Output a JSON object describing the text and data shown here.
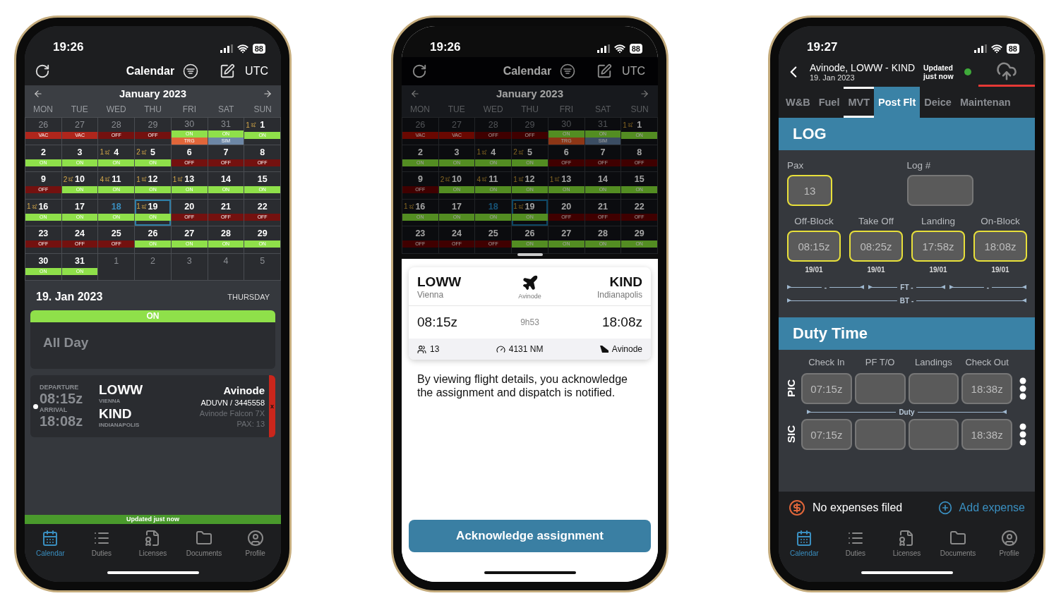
{
  "phones": [
    {
      "kind": "calendar",
      "status": {
        "time": "19:26",
        "battery": "88"
      },
      "header": {
        "title": "Calendar",
        "timezone": "UTC"
      },
      "month": "January 2023",
      "weekdays": [
        "MON",
        "TUE",
        "WED",
        "THU",
        "FRI",
        "SAT",
        "SUN"
      ],
      "weeks": [
        [
          {
            "day": "26",
            "outside": true,
            "today": false,
            "selected": false,
            "duties": [
              {
                "kind": "vac",
                "label": "VAC"
              }
            ]
          },
          {
            "day": "27",
            "outside": true,
            "today": false,
            "selected": false,
            "duties": [
              {
                "kind": "vac",
                "label": "VAC"
              }
            ]
          },
          {
            "day": "28",
            "outside": true,
            "today": false,
            "selected": false,
            "duties": [
              {
                "kind": "off",
                "label": "OFF"
              }
            ]
          },
          {
            "day": "29",
            "outside": true,
            "today": false,
            "selected": false,
            "duties": [
              {
                "kind": "off",
                "label": "OFF"
              }
            ]
          },
          {
            "day": "30",
            "outside": true,
            "today": false,
            "selected": false,
            "duties": [
              {
                "kind": "on",
                "label": "ON"
              },
              {
                "kind": "trg",
                "label": "TRG"
              }
            ]
          },
          {
            "day": "31",
            "outside": true,
            "today": false,
            "selected": false,
            "duties": [
              {
                "kind": "on",
                "label": "ON"
              },
              {
                "kind": "sim",
                "label": "SIM"
              }
            ]
          },
          {
            "day": "1",
            "flights": "1",
            "outside": false,
            "today": false,
            "selected": false,
            "duties": [
              {
                "kind": "on",
                "label": "ON"
              }
            ]
          }
        ],
        [
          {
            "day": "2",
            "outside": false,
            "today": false,
            "selected": false,
            "duties": [
              {
                "kind": "on",
                "label": "ON"
              }
            ]
          },
          {
            "day": "3",
            "outside": false,
            "today": false,
            "selected": false,
            "duties": [
              {
                "kind": "on",
                "label": "ON"
              }
            ]
          },
          {
            "day": "4",
            "flights": "1",
            "outside": false,
            "today": false,
            "selected": false,
            "duties": [
              {
                "kind": "on",
                "label": "ON"
              }
            ]
          },
          {
            "day": "5",
            "flights": "2",
            "outside": false,
            "today": false,
            "selected": false,
            "duties": [
              {
                "kind": "on",
                "label": "ON"
              }
            ]
          },
          {
            "day": "6",
            "outside": false,
            "today": false,
            "selected": false,
            "duties": [
              {
                "kind": "off",
                "label": "OFF"
              }
            ]
          },
          {
            "day": "7",
            "outside": false,
            "today": false,
            "selected": false,
            "duties": [
              {
                "kind": "off",
                "label": "OFF"
              }
            ]
          },
          {
            "day": "8",
            "outside": false,
            "today": false,
            "selected": false,
            "duties": [
              {
                "kind": "off",
                "label": "OFF"
              }
            ]
          }
        ],
        [
          {
            "day": "9",
            "outside": false,
            "today": false,
            "selected": false,
            "duties": [
              {
                "kind": "off",
                "label": "OFF"
              }
            ]
          },
          {
            "day": "10",
            "flights": "2",
            "outside": false,
            "today": false,
            "selected": false,
            "duties": [
              {
                "kind": "on",
                "label": "ON"
              }
            ]
          },
          {
            "day": "11",
            "flights": "4",
            "outside": false,
            "today": false,
            "selected": false,
            "duties": [
              {
                "kind": "on",
                "label": "ON"
              }
            ]
          },
          {
            "day": "12",
            "flights": "1",
            "outside": false,
            "today": false,
            "selected": false,
            "duties": [
              {
                "kind": "on",
                "label": "ON"
              }
            ]
          },
          {
            "day": "13",
            "flights": "1",
            "outside": false,
            "today": false,
            "selected": false,
            "duties": [
              {
                "kind": "on",
                "label": "ON"
              }
            ]
          },
          {
            "day": "14",
            "outside": false,
            "today": false,
            "selected": false,
            "duties": [
              {
                "kind": "on",
                "label": "ON"
              }
            ]
          },
          {
            "day": "15",
            "outside": false,
            "today": false,
            "selected": false,
            "duties": [
              {
                "kind": "on",
                "label": "ON"
              }
            ]
          }
        ],
        [
          {
            "day": "16",
            "flights": "1",
            "outside": false,
            "today": false,
            "selected": false,
            "duties": [
              {
                "kind": "on",
                "label": "ON"
              }
            ]
          },
          {
            "day": "17",
            "outside": false,
            "today": false,
            "selected": false,
            "duties": [
              {
                "kind": "on",
                "label": "ON"
              }
            ]
          },
          {
            "day": "18",
            "outside": false,
            "today": true,
            "selected": false,
            "duties": [
              {
                "kind": "on",
                "label": "ON"
              }
            ]
          },
          {
            "day": "19",
            "flights": "1",
            "outside": false,
            "today": false,
            "selected": true,
            "duties": [
              {
                "kind": "on",
                "label": "ON"
              }
            ]
          },
          {
            "day": "20",
            "outside": false,
            "today": false,
            "selected": false,
            "duties": [
              {
                "kind": "off",
                "label": "OFF"
              }
            ]
          },
          {
            "day": "21",
            "outside": false,
            "today": false,
            "selected": false,
            "duties": [
              {
                "kind": "off",
                "label": "OFF"
              }
            ]
          },
          {
            "day": "22",
            "outside": false,
            "today": false,
            "selected": false,
            "duties": [
              {
                "kind": "off",
                "label": "OFF"
              }
            ]
          }
        ],
        [
          {
            "day": "23",
            "outside": false,
            "today": false,
            "selected": false,
            "duties": [
              {
                "kind": "off",
                "label": "OFF"
              }
            ]
          },
          {
            "day": "24",
            "outside": false,
            "today": false,
            "selected": false,
            "duties": [
              {
                "kind": "off",
                "label": "OFF"
              }
            ]
          },
          {
            "day": "25",
            "outside": false,
            "today": false,
            "selected": false,
            "duties": [
              {
                "kind": "off",
                "label": "OFF"
              }
            ]
          },
          {
            "day": "26",
            "outside": false,
            "today": false,
            "selected": false,
            "duties": [
              {
                "kind": "on",
                "label": "ON"
              }
            ]
          },
          {
            "day": "27",
            "outside": false,
            "today": false,
            "selected": false,
            "duties": [
              {
                "kind": "on",
                "label": "ON"
              }
            ]
          },
          {
            "day": "28",
            "outside": false,
            "today": false,
            "selected": false,
            "duties": [
              {
                "kind": "on",
                "label": "ON"
              }
            ]
          },
          {
            "day": "29",
            "outside": false,
            "today": false,
            "selected": false,
            "duties": [
              {
                "kind": "on",
                "label": "ON"
              }
            ]
          }
        ],
        [
          {
            "day": "30",
            "outside": false,
            "today": false,
            "selected": false,
            "duties": [
              {
                "kind": "on",
                "label": "ON"
              }
            ]
          },
          {
            "day": "31",
            "outside": false,
            "today": false,
            "selected": false,
            "duties": [
              {
                "kind": "on",
                "label": "ON"
              }
            ]
          },
          {
            "day": "1",
            "outside": true,
            "today": false,
            "selected": false
          },
          {
            "day": "2",
            "outside": true,
            "today": false,
            "selected": false
          },
          {
            "day": "3",
            "outside": true,
            "today": false,
            "selected": false
          },
          {
            "day": "4",
            "outside": true,
            "today": false,
            "selected": false
          },
          {
            "day": "5",
            "outside": true,
            "today": false,
            "selected": false
          }
        ]
      ],
      "day_detail": {
        "date": "19. Jan 2023",
        "weekday": "THURSDAY",
        "status": {
          "kind": "on",
          "label": "ON"
        },
        "all_day": "All Day"
      },
      "flight": {
        "departure_label": "DEPARTURE",
        "departure_time": "08:15z",
        "arrival_label": "ARRIVAL",
        "arrival_time": "18:08z",
        "from": "LOWW",
        "from_city": "VIENNA",
        "to": "KIND",
        "to_city": "INDIANAPOLIS",
        "client": "Avinode",
        "reference": "ADUVN / 3445558",
        "aircraft": "Avinode Falcon 7X",
        "pax": "PAX: 13",
        "flag": "x"
      },
      "sync_banner": "Updated just now",
      "tabbar": [
        {
          "label": "Calendar",
          "selected": true
        },
        {
          "label": "Duties",
          "selected": false
        },
        {
          "label": "Licenses",
          "selected": false
        },
        {
          "label": "Documents",
          "selected": false
        },
        {
          "label": "Profile",
          "selected": false
        }
      ]
    },
    {
      "kind": "sheet",
      "status": {
        "time": "19:26",
        "battery": "88"
      },
      "header": {
        "title": "Calendar",
        "timezone": "UTC"
      },
      "month": "January 2023",
      "weekdays": [
        "MON",
        "TUE",
        "WED",
        "THU",
        "FRI",
        "SAT",
        "SUN"
      ],
      "weeks": [
        [
          {
            "day": "26",
            "outside": true,
            "today": false,
            "selected": false,
            "duties": [
              {
                "kind": "vac",
                "label": "VAC"
              }
            ]
          },
          {
            "day": "27",
            "outside": true,
            "today": false,
            "selected": false,
            "duties": [
              {
                "kind": "vac",
                "label": "VAC"
              }
            ]
          },
          {
            "day": "28",
            "outside": true,
            "today": false,
            "selected": false,
            "duties": [
              {
                "kind": "off",
                "label": "OFF"
              }
            ]
          },
          {
            "day": "29",
            "outside": true,
            "today": false,
            "selected": false,
            "duties": [
              {
                "kind": "off",
                "label": "OFF"
              }
            ]
          },
          {
            "day": "30",
            "outside": true,
            "today": false,
            "selected": false,
            "duties": [
              {
                "kind": "on",
                "label": "ON"
              },
              {
                "kind": "trg",
                "label": "TRG"
              }
            ]
          },
          {
            "day": "31",
            "outside": true,
            "today": false,
            "selected": false,
            "duties": [
              {
                "kind": "on",
                "label": "ON"
              },
              {
                "kind": "sim",
                "label": "SIM"
              }
            ]
          },
          {
            "day": "1",
            "flights": "1",
            "outside": false,
            "today": false,
            "selected": false,
            "duties": [
              {
                "kind": "on",
                "label": "ON"
              }
            ]
          }
        ],
        [
          {
            "day": "2",
            "outside": false,
            "today": false,
            "selected": false,
            "duties": [
              {
                "kind": "on",
                "label": "ON"
              }
            ]
          },
          {
            "day": "3",
            "outside": false,
            "today": false,
            "selected": false,
            "duties": [
              {
                "kind": "on",
                "label": "ON"
              }
            ]
          },
          {
            "day": "4",
            "flights": "1",
            "outside": false,
            "today": false,
            "selected": false,
            "duties": [
              {
                "kind": "on",
                "label": "ON"
              }
            ]
          },
          {
            "day": "5",
            "flights": "2",
            "outside": false,
            "today": false,
            "selected": false,
            "duties": [
              {
                "kind": "on",
                "label": "ON"
              }
            ]
          },
          {
            "day": "6",
            "outside": false,
            "today": false,
            "selected": false,
            "duties": [
              {
                "kind": "off",
                "label": "OFF"
              }
            ]
          },
          {
            "day": "7",
            "outside": false,
            "today": false,
            "selected": false,
            "duties": [
              {
                "kind": "off",
                "label": "OFF"
              }
            ]
          },
          {
            "day": "8",
            "outside": false,
            "today": false,
            "selected": false,
            "duties": [
              {
                "kind": "off",
                "label": "OFF"
              }
            ]
          }
        ],
        [
          {
            "day": "9",
            "outside": false,
            "today": false,
            "selected": false,
            "duties": [
              {
                "kind": "off",
                "label": "OFF"
              }
            ]
          },
          {
            "day": "10",
            "flights": "2",
            "outside": false,
            "today": false,
            "selected": false,
            "duties": [
              {
                "kind": "on",
                "label": "ON"
              }
            ]
          },
          {
            "day": "11",
            "flights": "4",
            "outside": false,
            "today": false,
            "selected": false,
            "duties": [
              {
                "kind": "on",
                "label": "ON"
              }
            ]
          },
          {
            "day": "12",
            "flights": "1",
            "outside": false,
            "today": false,
            "selected": false,
            "duties": [
              {
                "kind": "on",
                "label": "ON"
              }
            ]
          },
          {
            "day": "13",
            "flights": "1",
            "outside": false,
            "today": false,
            "selected": false,
            "duties": [
              {
                "kind": "on",
                "label": "ON"
              }
            ]
          },
          {
            "day": "14",
            "outside": false,
            "today": false,
            "selected": false,
            "duties": [
              {
                "kind": "on",
                "label": "ON"
              }
            ]
          },
          {
            "day": "15",
            "outside": false,
            "today": false,
            "selected": false,
            "duties": [
              {
                "kind": "on",
                "label": "ON"
              }
            ]
          }
        ],
        [
          {
            "day": "16",
            "flights": "1",
            "outside": false,
            "today": false,
            "selected": false,
            "duties": [
              {
                "kind": "on",
                "label": "ON"
              }
            ]
          },
          {
            "day": "17",
            "outside": false,
            "today": false,
            "selected": false,
            "duties": [
              {
                "kind": "on",
                "label": "ON"
              }
            ]
          },
          {
            "day": "18",
            "outside": false,
            "today": true,
            "selected": false,
            "duties": [
              {
                "kind": "on",
                "label": "ON"
              }
            ]
          },
          {
            "day": "19",
            "flights": "1",
            "outside": false,
            "today": false,
            "selected": true,
            "duties": [
              {
                "kind": "on",
                "label": "ON"
              }
            ]
          },
          {
            "day": "20",
            "outside": false,
            "today": false,
            "selected": false,
            "duties": [
              {
                "kind": "off",
                "label": "OFF"
              }
            ]
          },
          {
            "day": "21",
            "outside": false,
            "today": false,
            "selected": false,
            "duties": [
              {
                "kind": "off",
                "label": "OFF"
              }
            ]
          },
          {
            "day": "22",
            "outside": false,
            "today": false,
            "selected": false,
            "duties": [
              {
                "kind": "off",
                "label": "OFF"
              }
            ]
          }
        ],
        [
          {
            "day": "23",
            "outside": false,
            "today": false,
            "selected": false,
            "duties": [
              {
                "kind": "off",
                "label": "OFF"
              }
            ]
          },
          {
            "day": "24",
            "outside": false,
            "today": false,
            "selected": false,
            "duties": [
              {
                "kind": "off",
                "label": "OFF"
              }
            ]
          },
          {
            "day": "25",
            "outside": false,
            "today": false,
            "selected": false,
            "duties": [
              {
                "kind": "off",
                "label": "OFF"
              }
            ]
          },
          {
            "day": "26",
            "outside": false,
            "today": false,
            "selected": false,
            "duties": [
              {
                "kind": "on",
                "label": "ON"
              }
            ]
          },
          {
            "day": "27",
            "outside": false,
            "today": false,
            "selected": false,
            "duties": [
              {
                "kind": "on",
                "label": "ON"
              }
            ]
          },
          {
            "day": "28",
            "outside": false,
            "today": false,
            "selected": false,
            "duties": [
              {
                "kind": "on",
                "label": "ON"
              }
            ]
          },
          {
            "day": "29",
            "outside": false,
            "today": false,
            "selected": false,
            "duties": [
              {
                "kind": "on",
                "label": "ON"
              }
            ]
          }
        ]
      ],
      "sheet": {
        "from": "LOWW",
        "from_city": "Vienna",
        "carrier": "Avinode",
        "to": "KIND",
        "to_city": "Indianapolis",
        "departure_time": "08:15z",
        "duration": "9h53",
        "arrival_time": "18:08z",
        "pax": "13",
        "distance": "4131 NM",
        "operator": "Avinode",
        "notice": "By viewing flight details, you acknowledge the assignment and dispatch is notified.",
        "button": "Acknowledge assignment"
      }
    },
    {
      "kind": "postflight",
      "status": {
        "time": "19:27",
        "battery": "88"
      },
      "header": {
        "title": "Avinode, LOWW - KIND",
        "date": "19. Jan 2023",
        "sync": "Updated just now",
        "synced": true,
        "upload_pending": true
      },
      "tabs": [
        {
          "label": "W&B",
          "selected": false,
          "marked": false
        },
        {
          "label": "Fuel",
          "selected": false,
          "marked": false
        },
        {
          "label": "MVT",
          "selected": false,
          "marked": true
        },
        {
          "label": "Post Flt",
          "selected": true,
          "marked": false
        },
        {
          "label": "Deice",
          "selected": false,
          "marked": false
        },
        {
          "label": "Maintenan",
          "selected": false,
          "marked": false
        }
      ],
      "log": {
        "title": "LOG",
        "fields": [
          {
            "label": "Pax",
            "value": "13",
            "highlighted": true
          },
          {
            "label": "Log #",
            "highlighted": false
          }
        ],
        "times": [
          {
            "label": "Off-Block",
            "value": "08:15z",
            "date": "19/01",
            "highlighted": true
          },
          {
            "label": "Take Off",
            "value": "08:25z",
            "date": "19/01",
            "highlighted": true
          },
          {
            "label": "Landing",
            "value": "17:58z",
            "date": "19/01",
            "highlighted": true
          },
          {
            "label": "On-Block",
            "value": "18:08z",
            "date": "19/01",
            "highlighted": true
          }
        ],
        "flight_spans": [
          "-",
          "FT -",
          "-"
        ],
        "block_span": "BT -"
      },
      "duty": {
        "title": "Duty Time",
        "columns": [
          "Check In",
          "PF T/O",
          "Landings",
          "Check Out"
        ],
        "rows": [
          {
            "role": "PIC",
            "cells": [
              {
                "value": "07:15z"
              },
              {},
              {},
              {
                "value": "18:38z"
              }
            ],
            "span": "Duty"
          },
          {
            "role": "SIC",
            "cells": [
              {
                "value": "07:15z"
              },
              {},
              {},
              {
                "value": "18:38z"
              }
            ]
          }
        ]
      },
      "expenses": {
        "text": "No expenses filed",
        "action": "Add expense"
      },
      "tabbar": [
        {
          "label": "Calendar",
          "selected": true
        },
        {
          "label": "Duties",
          "selected": false
        },
        {
          "label": "Licenses",
          "selected": false
        },
        {
          "label": "Documents",
          "selected": false
        },
        {
          "label": "Profile",
          "selected": false
        }
      ]
    }
  ]
}
